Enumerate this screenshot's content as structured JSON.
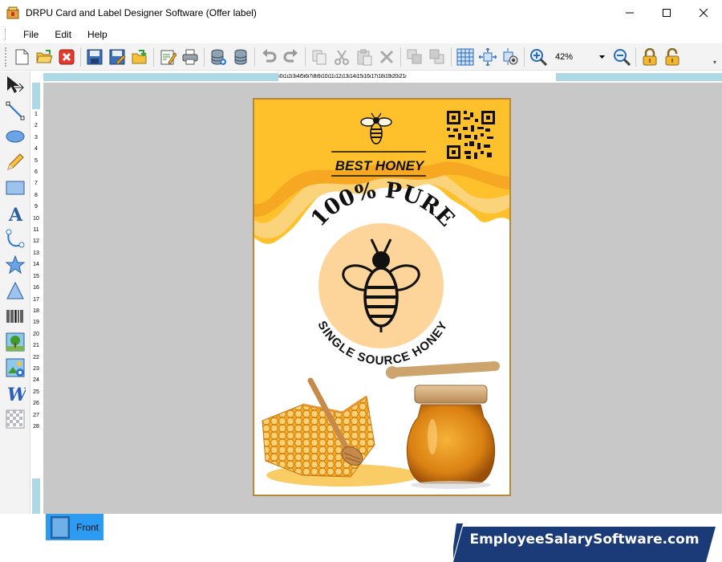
{
  "window": {
    "title": "DRPU Card and Label Designer Software (Offer label)"
  },
  "menu": {
    "file": "File",
    "edit": "Edit",
    "help": "Help"
  },
  "toolbar": {
    "zoom_value": "42%"
  },
  "ruler": {
    "top_scale": "ı0ı1ı2ı3ı4ı5ı6ı7ı8ı9ı10ı11ı12ı13ı14ı15ı16ı17ı18ı19ı20ı21ı",
    "left_ticks": [
      "1",
      "2",
      "3",
      "4",
      "5",
      "6",
      "7",
      "8",
      "9",
      "10",
      "11",
      "12",
      "13",
      "14",
      "15",
      "16",
      "17",
      "18",
      "19",
      "20",
      "21",
      "22",
      "23",
      "24",
      "25",
      "26",
      "27",
      "28"
    ]
  },
  "label": {
    "heading": "BEST HONEY",
    "arc_top": "100% PURE",
    "arc_bottom": "SINGLE SOURCE HONEY"
  },
  "tabs": {
    "front": "Front"
  },
  "brand": {
    "text": "EmployeeSalarySoftware.com"
  },
  "colors": {
    "accent": "#2b9cf2",
    "ruler_track": "#add8e6",
    "canvas_bg": "#c8c8c8",
    "honey_yellow": "#fec12b",
    "honey_orange": "#f7a823",
    "peach_circle": "#fdd59b"
  }
}
